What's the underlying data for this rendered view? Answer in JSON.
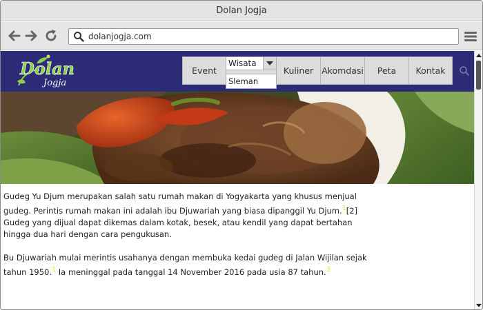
{
  "window": {
    "title": "Dolan Jogja"
  },
  "browser": {
    "url": "dolanjogja.com",
    "back_icon": "arrow-left-icon",
    "forward_icon": "arrow-right-icon",
    "reload_icon": "reload-icon",
    "menu_icon": "hamburger-menu-icon"
  },
  "site": {
    "logo": {
      "main": "Dolan",
      "sub": "Jogja"
    },
    "nav": {
      "event": "Event",
      "wisata": "Wisata",
      "wisata_option": "Sleman",
      "kuliner": "Kuliner",
      "akomodasi": "Akomdasi",
      "peta": "Peta",
      "kontak": "Kontak"
    },
    "colors": {
      "nav_bg": "#2b2b76",
      "logo_green": "#8fd14f",
      "citation": "#f0d94a"
    }
  },
  "article": {
    "p1_text": "Gudeg Yu Djum merupakan salah satu rumah makan di Yogyakarta yang khusus menjual gudeg. Perintis rumah makan ini adalah ibu Djuwariah yang biasa dipanggil Yu Djum.",
    "p1_cite1": "1",
    "p1_cite2": "[2]",
    "p1_rest": " Gudeg yang dijual dapat dikemas dalam kotak, besek, atau kendil yang dapat bertahan hingga dua hari dengan cara pengukusan.",
    "p2_text": "Bu Djuwariah mulai merintis usahanya dengan membuka kedai gudeg di Jalan Wijilan sejak tahun 1950.",
    "p2_cite1": "1",
    "p2_rest": " Ia meninggal pada tanggal 14 November 2016 pada usia 87 tahun.",
    "p2_cite2": "3"
  }
}
